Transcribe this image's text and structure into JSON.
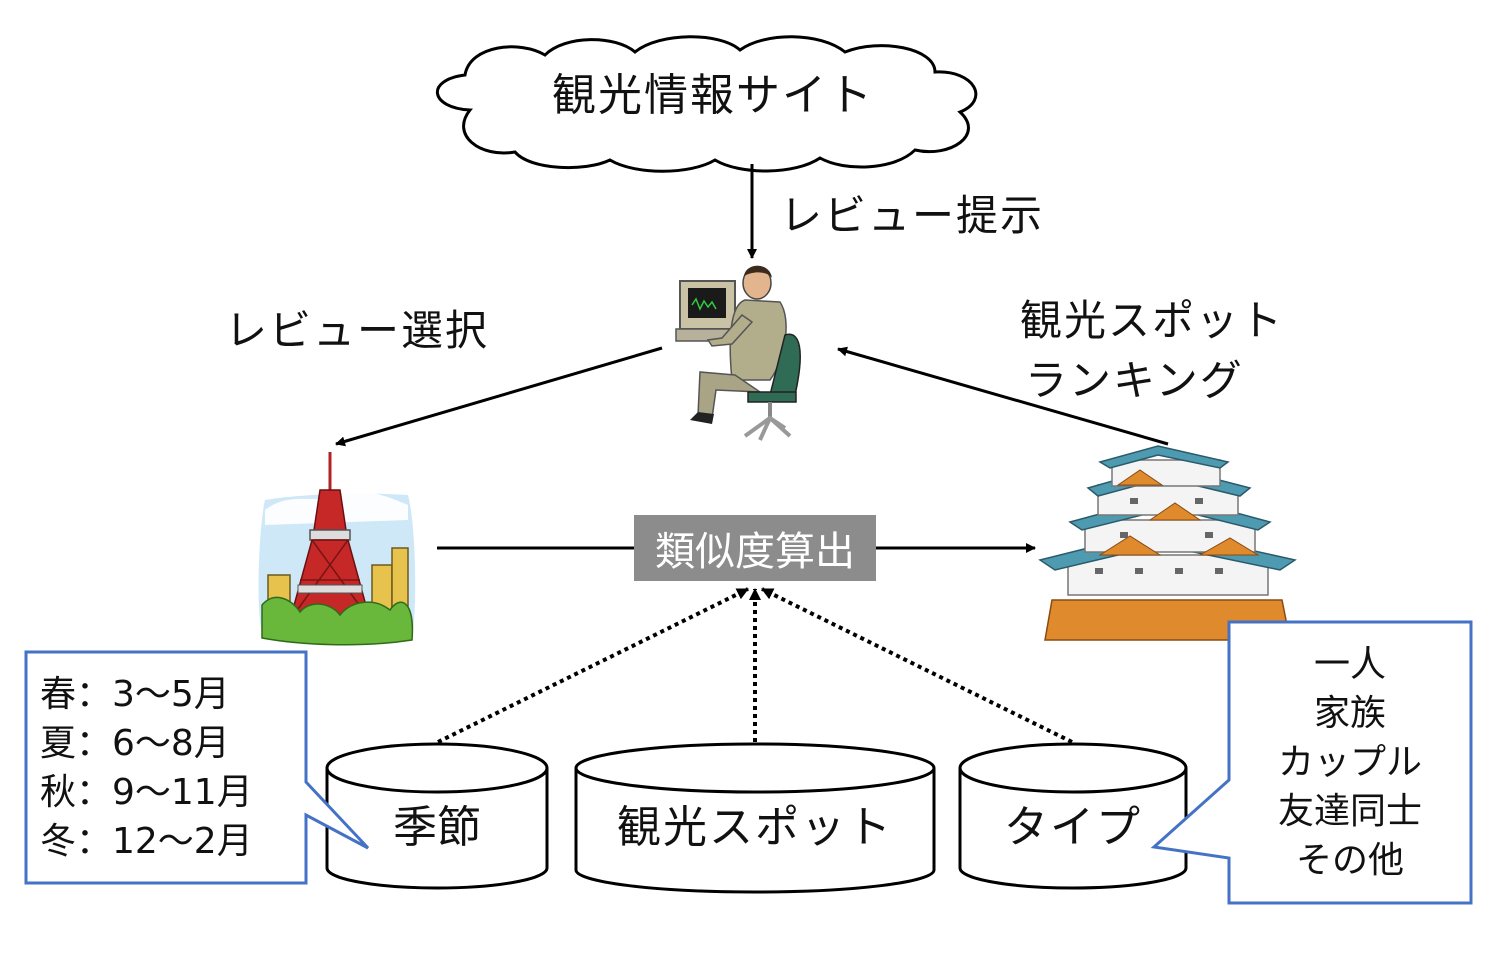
{
  "site": {
    "label": "観光情報サイト"
  },
  "flows": {
    "review_present": "レビュー提示",
    "review_select": "レビュー選択",
    "ranking_line1": "観光スポット",
    "ranking_line2": "ランキング"
  },
  "process": {
    "label": "類似度算出"
  },
  "databases": {
    "season": "季節",
    "spot": "観光スポット",
    "type": "タイプ"
  },
  "season_callout": {
    "items": [
      "春：3〜5月",
      "夏：6〜8月",
      "秋：9〜11月",
      "冬：12〜2月"
    ]
  },
  "type_callout": {
    "items": [
      "一人",
      "家族",
      "カップル",
      "友達同士",
      "その他"
    ]
  },
  "colors": {
    "process_box": "#8c8c8c",
    "callout_border": "#4472c4",
    "line": "#000000"
  }
}
